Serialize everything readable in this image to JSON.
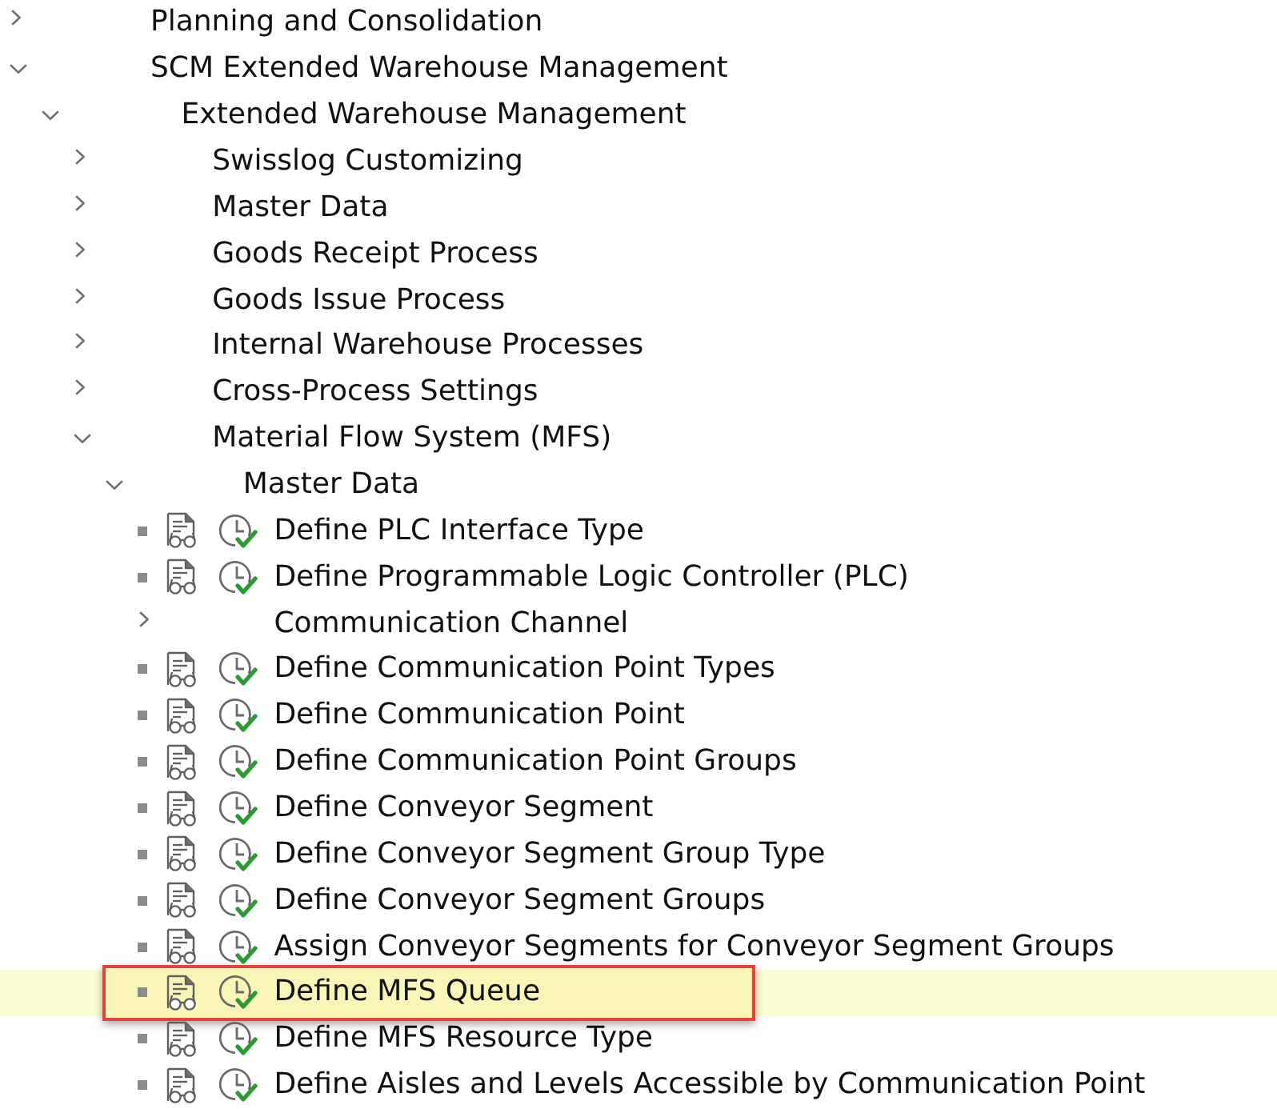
{
  "tree": {
    "items": [
      {
        "kind": "folder",
        "label": "Planning and Consolidation",
        "expanded": false,
        "selected": false,
        "highlighted": false
      },
      {
        "kind": "folder",
        "label": "SCM Extended Warehouse Management",
        "expanded": true,
        "selected": false,
        "highlighted": false,
        "children": [
          {
            "kind": "folder",
            "label": "Extended Warehouse Management",
            "expanded": true,
            "selected": false,
            "highlighted": false,
            "children": [
              {
                "kind": "folder",
                "label": "Swisslog Customizing",
                "expanded": false,
                "selected": false,
                "highlighted": false
              },
              {
                "kind": "folder",
                "label": "Master Data",
                "expanded": false,
                "selected": false,
                "highlighted": false
              },
              {
                "kind": "folder",
                "label": "Goods Receipt Process",
                "expanded": false,
                "selected": false,
                "highlighted": false
              },
              {
                "kind": "folder",
                "label": "Goods Issue Process",
                "expanded": false,
                "selected": false,
                "highlighted": false
              },
              {
                "kind": "folder",
                "label": "Internal Warehouse Processes",
                "expanded": false,
                "selected": false,
                "highlighted": false
              },
              {
                "kind": "folder",
                "label": "Cross-Process Settings",
                "expanded": false,
                "selected": false,
                "highlighted": false
              },
              {
                "kind": "folder",
                "label": "Material Flow System (MFS)",
                "expanded": true,
                "selected": false,
                "highlighted": false,
                "children": [
                  {
                    "kind": "folder",
                    "label": "Master Data",
                    "expanded": true,
                    "selected": false,
                    "highlighted": false,
                    "children": [
                      {
                        "kind": "activity",
                        "label": "Define PLC Interface Type",
                        "selected": false,
                        "highlighted": false
                      },
                      {
                        "kind": "activity",
                        "label": "Define Programmable Logic Controller (PLC)",
                        "selected": false,
                        "highlighted": false
                      },
                      {
                        "kind": "folder",
                        "label": "Communication Channel",
                        "expanded": false,
                        "selected": false,
                        "highlighted": false
                      },
                      {
                        "kind": "activity",
                        "label": "Define Communication Point Types",
                        "selected": false,
                        "highlighted": false
                      },
                      {
                        "kind": "activity",
                        "label": "Define Communication Point",
                        "selected": false,
                        "highlighted": false
                      },
                      {
                        "kind": "activity",
                        "label": "Define Communication Point Groups",
                        "selected": false,
                        "highlighted": false
                      },
                      {
                        "kind": "activity",
                        "label": "Define Conveyor Segment",
                        "selected": false,
                        "highlighted": false
                      },
                      {
                        "kind": "activity",
                        "label": "Define Conveyor Segment Group Type",
                        "selected": false,
                        "highlighted": false
                      },
                      {
                        "kind": "activity",
                        "label": "Define Conveyor Segment Groups",
                        "selected": false,
                        "highlighted": false
                      },
                      {
                        "kind": "activity",
                        "label": "Assign Conveyor Segments for Conveyor Segment Groups",
                        "selected": false,
                        "highlighted": false
                      },
                      {
                        "kind": "activity",
                        "label": "Define MFS Queue",
                        "selected": true,
                        "highlighted": true
                      },
                      {
                        "kind": "activity",
                        "label": "Define MFS Resource Type",
                        "selected": false,
                        "highlighted": false
                      },
                      {
                        "kind": "activity",
                        "label": "Define Aisles and Levels Accessible by Communication Point",
                        "selected": false,
                        "highlighted": false
                      }
                    ]
                  }
                ]
              }
            ]
          }
        ]
      }
    ]
  }
}
